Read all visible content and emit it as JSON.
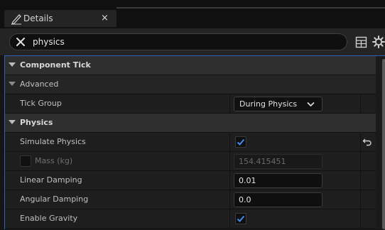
{
  "tab": {
    "title": "Details",
    "close_glyph": "×",
    "icon": "pencil-icon"
  },
  "search": {
    "value": "physics",
    "clear_icon": "close-icon"
  },
  "toolbar": {
    "view_icon": "grid-icon",
    "settings_icon": "gear-icon"
  },
  "sections": {
    "component_tick": {
      "label": "Component Tick",
      "advanced": {
        "label": "Advanced"
      },
      "tick_group": {
        "label": "Tick Group",
        "value": "During Physics"
      }
    },
    "physics": {
      "label": "Physics",
      "simulate_physics": {
        "label": "Simulate Physics",
        "checked": true,
        "reset_icon": "reset-arrow-icon"
      },
      "mass": {
        "label": "Mass (kg)",
        "value": "154.415451",
        "override_checked": false
      },
      "linear_damping": {
        "label": "Linear Damping",
        "value": "0.01"
      },
      "angular_damping": {
        "label": "Angular Damping",
        "value": "0.0"
      },
      "enable_gravity": {
        "label": "Enable Gravity",
        "checked": true
      }
    }
  },
  "colors": {
    "accent": "#2b63b8",
    "check": "#3a8ef0",
    "background": "#1a1a1a"
  }
}
